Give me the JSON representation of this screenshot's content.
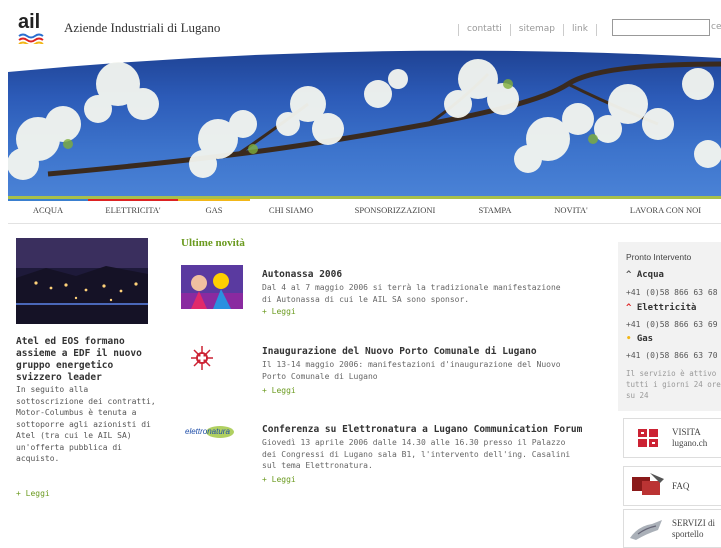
{
  "header": {
    "logo_text": "ail",
    "site_title": "Aziende Industriali di Lugano",
    "links": [
      "contatti",
      "sitemap",
      "link"
    ],
    "search_button": "ce"
  },
  "nav": {
    "items": [
      {
        "label": "ACQUA",
        "color": "#3a7fcf"
      },
      {
        "label": "ELETTRICITA'",
        "color": "#d22"
      },
      {
        "label": "GAS",
        "color": "#f2b718"
      },
      {
        "label": "CHI SIAMO",
        "color": ""
      },
      {
        "label": "SPONSORIZZAZIONI",
        "color": ""
      },
      {
        "label": "STAMPA",
        "color": ""
      },
      {
        "label": "NOVITA'",
        "color": ""
      },
      {
        "label": "LAVORA CON NOI",
        "color": ""
      }
    ]
  },
  "left": {
    "title": "Atel ed EOS formano assieme a EDF il nuovo gruppo energetico svizzero leader",
    "body": "In seguito alla sottoscrizione dei contratti, Motor-Columbus è tenuta a sottoporre agli azionisti di Atel (tra cui le AIL SA) un'offerta pubblica di acquisto.",
    "leggi": "+ Leggi"
  },
  "main": {
    "section_title": "Ultime novità",
    "news": [
      {
        "title": "Autonassa 2006",
        "body": "Dal 4 al 7 maggio 2006 si terrà la tradizionale manifestazione di Autonassa di cui le AIL SA sono sponsor.",
        "leggi": "+ Leggi",
        "icon": "autonassa-photo"
      },
      {
        "title": "Inaugurazione del Nuovo Porto Comunale di Lugano",
        "body": "Il 13-14 maggio 2006: manifestazioni d'inaugurazione del Nuovo Porto Comunale di Lugano",
        "leggi": "+ Leggi",
        "icon": "lugano-emblem-icon"
      },
      {
        "title": "Conferenza su Elettronatura a Lugano Communication Forum",
        "body": "Giovedì 13 aprile 2006 dalle 14.30 alle 16.30 presso il Palazzo dei Congressi di Lugano sala B1, l'intervento dell'ing. Casalini sul tema Elettronatura.",
        "leggi": "+ Leggi",
        "icon": "elettronatura-logo",
        "logo_text": "elettronatura"
      }
    ]
  },
  "right": {
    "title": "Pronto Intervento",
    "services": [
      {
        "label": "Acqua",
        "phone": "+41 (0)58 866 63 68",
        "icon_color": "#555"
      },
      {
        "label": "Elettricità",
        "phone": "+41 (0)58 866 63 69",
        "icon_color": "#d22"
      },
      {
        "label": "Gas",
        "phone": "+41 (0)58 866 63 70",
        "icon_color": "#f2b718"
      }
    ],
    "note": "Il servizio è attivo tutti i giorni 24 ore su 24",
    "boxes": [
      {
        "label_line1": "VISITA",
        "label_line2": "lugano.ch",
        "icon": "lugano-shield-icon"
      },
      {
        "label_line1": "FAQ",
        "label_line2": "",
        "icon": "faq-icon"
      },
      {
        "label_line1": "SERVIZI di",
        "label_line2": "sportello",
        "icon": "sportello-icon"
      }
    ]
  }
}
